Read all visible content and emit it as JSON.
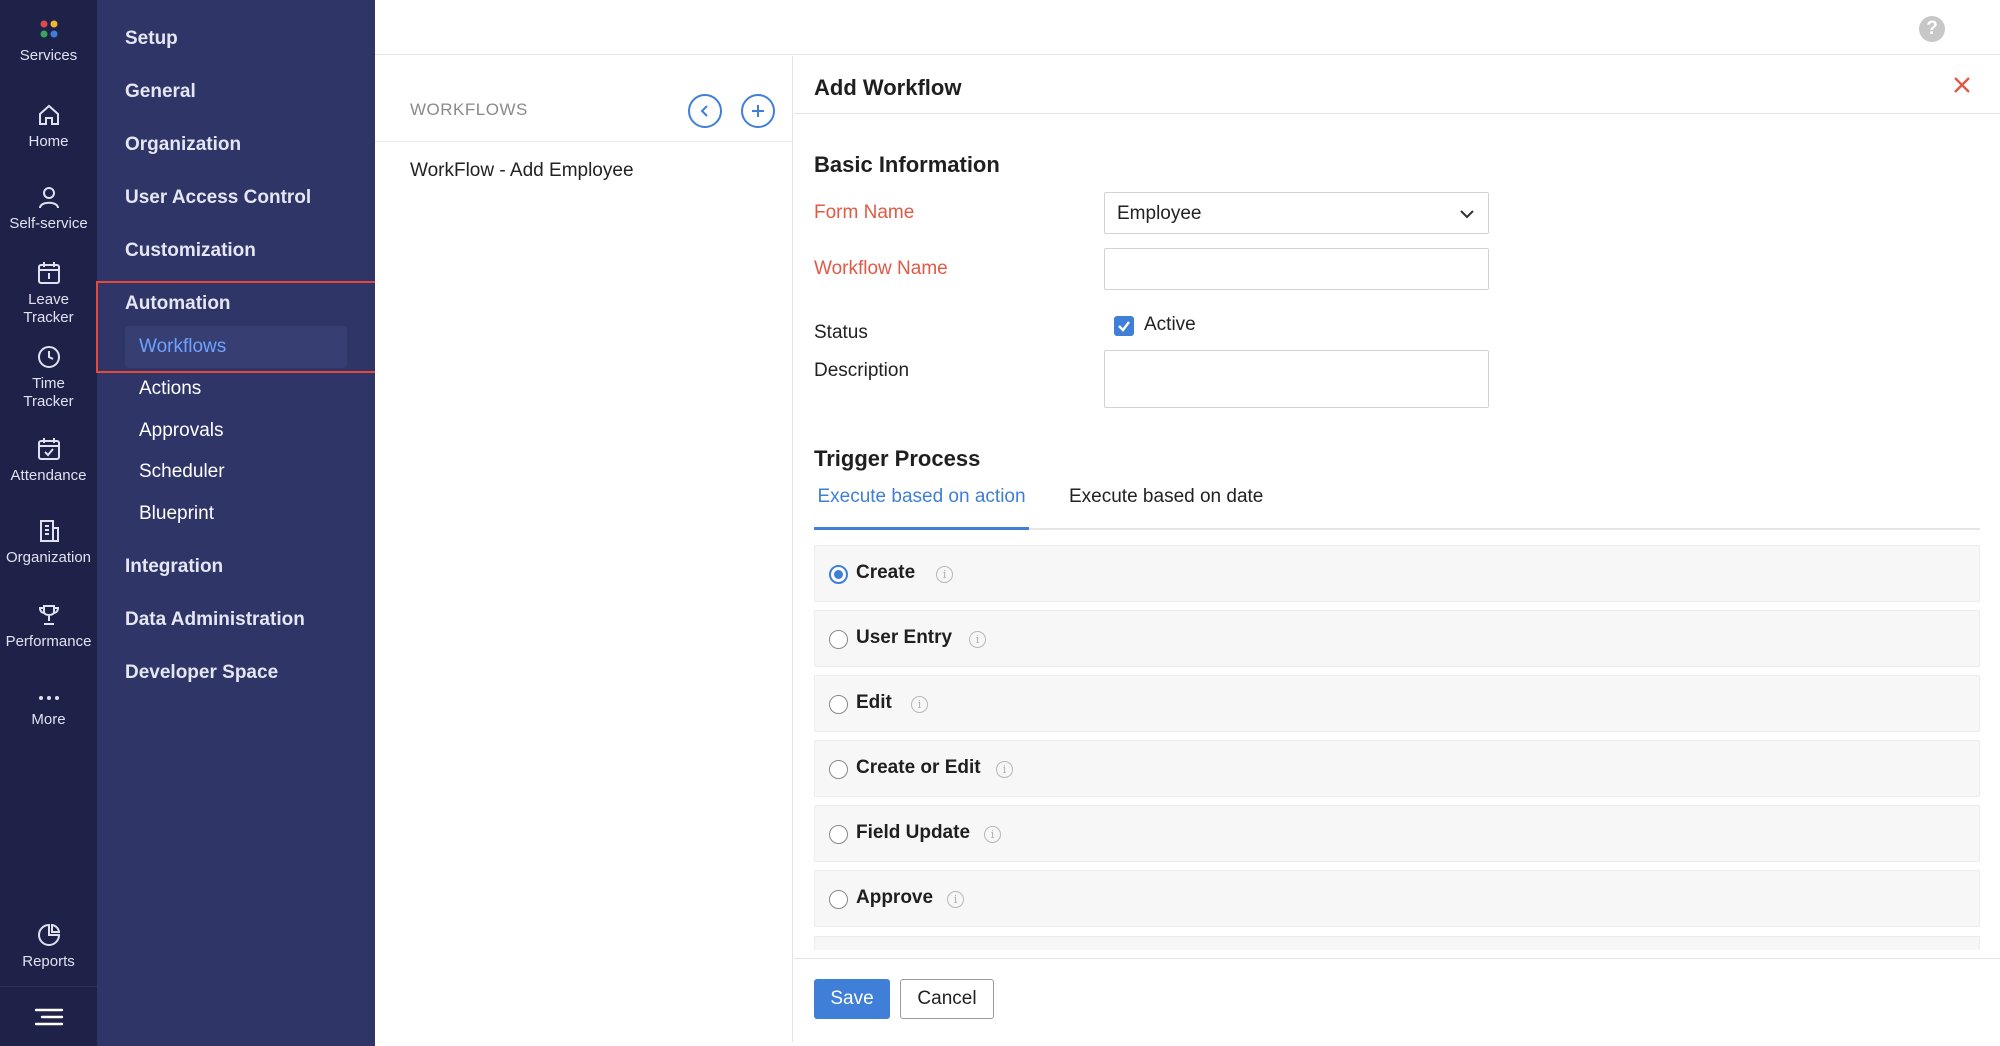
{
  "rail": {
    "items": [
      {
        "label": "Services",
        "icon": "services-dots-icon"
      },
      {
        "label": "Home",
        "icon": "home-icon"
      },
      {
        "label": "Self-service",
        "icon": "person-icon"
      },
      {
        "label": "Leave Tracker",
        "icon": "calendar-icon"
      },
      {
        "label": "Time Tracker",
        "icon": "clock-icon"
      },
      {
        "label": "Attendance",
        "icon": "calendar-check-icon"
      },
      {
        "label": "Organization",
        "icon": "building-icon"
      },
      {
        "label": "Performance",
        "icon": "trophy-icon"
      },
      {
        "label": "More",
        "icon": "more-dots-icon"
      },
      {
        "label": "Reports",
        "icon": "pie-chart-icon"
      }
    ],
    "menu_icon": "hamburger-icon"
  },
  "sidebar": {
    "items": {
      "setup": "Setup",
      "general": "General",
      "organization": "Organization",
      "user_access_control": "User Access Control",
      "customization": "Customization",
      "automation": "Automation",
      "integration": "Integration",
      "data_administration": "Data Administration",
      "developer_space": "Developer Space"
    },
    "automation_sub": {
      "workflows": "Workflows",
      "actions": "Actions",
      "approvals": "Approvals",
      "scheduler": "Scheduler",
      "blueprint": "Blueprint"
    }
  },
  "topbar": {
    "help": "?"
  },
  "workflows_list": {
    "title": "WORKFLOWS",
    "entries": [
      "WorkFlow - Add Employee"
    ]
  },
  "panel": {
    "title": "Add Workflow",
    "basic_info_title": "Basic Information",
    "form_name_label": "Form Name",
    "form_name_value": "Employee",
    "workflow_name_label": "Workflow Name",
    "workflow_name_value": "",
    "status_label": "Status",
    "status_checkbox_label": "Active",
    "status_active": true,
    "description_label": "Description",
    "description_value": "",
    "trigger_title": "Trigger Process",
    "tabs": {
      "action": "Execute based on action",
      "date": "Execute based on date"
    },
    "options": [
      "Create",
      "User Entry",
      "Edit",
      "Create or Edit",
      "Field Update",
      "Approve"
    ],
    "selected_option": "Create",
    "info_glyph": "i",
    "save_label": "Save",
    "cancel_label": "Cancel"
  },
  "colors": {
    "rail_bg": "#1e2248",
    "sidebar_bg": "#2f3566",
    "accent": "#3f7fd8",
    "required": "#e05a46",
    "highlight_box": "#e8473a"
  }
}
